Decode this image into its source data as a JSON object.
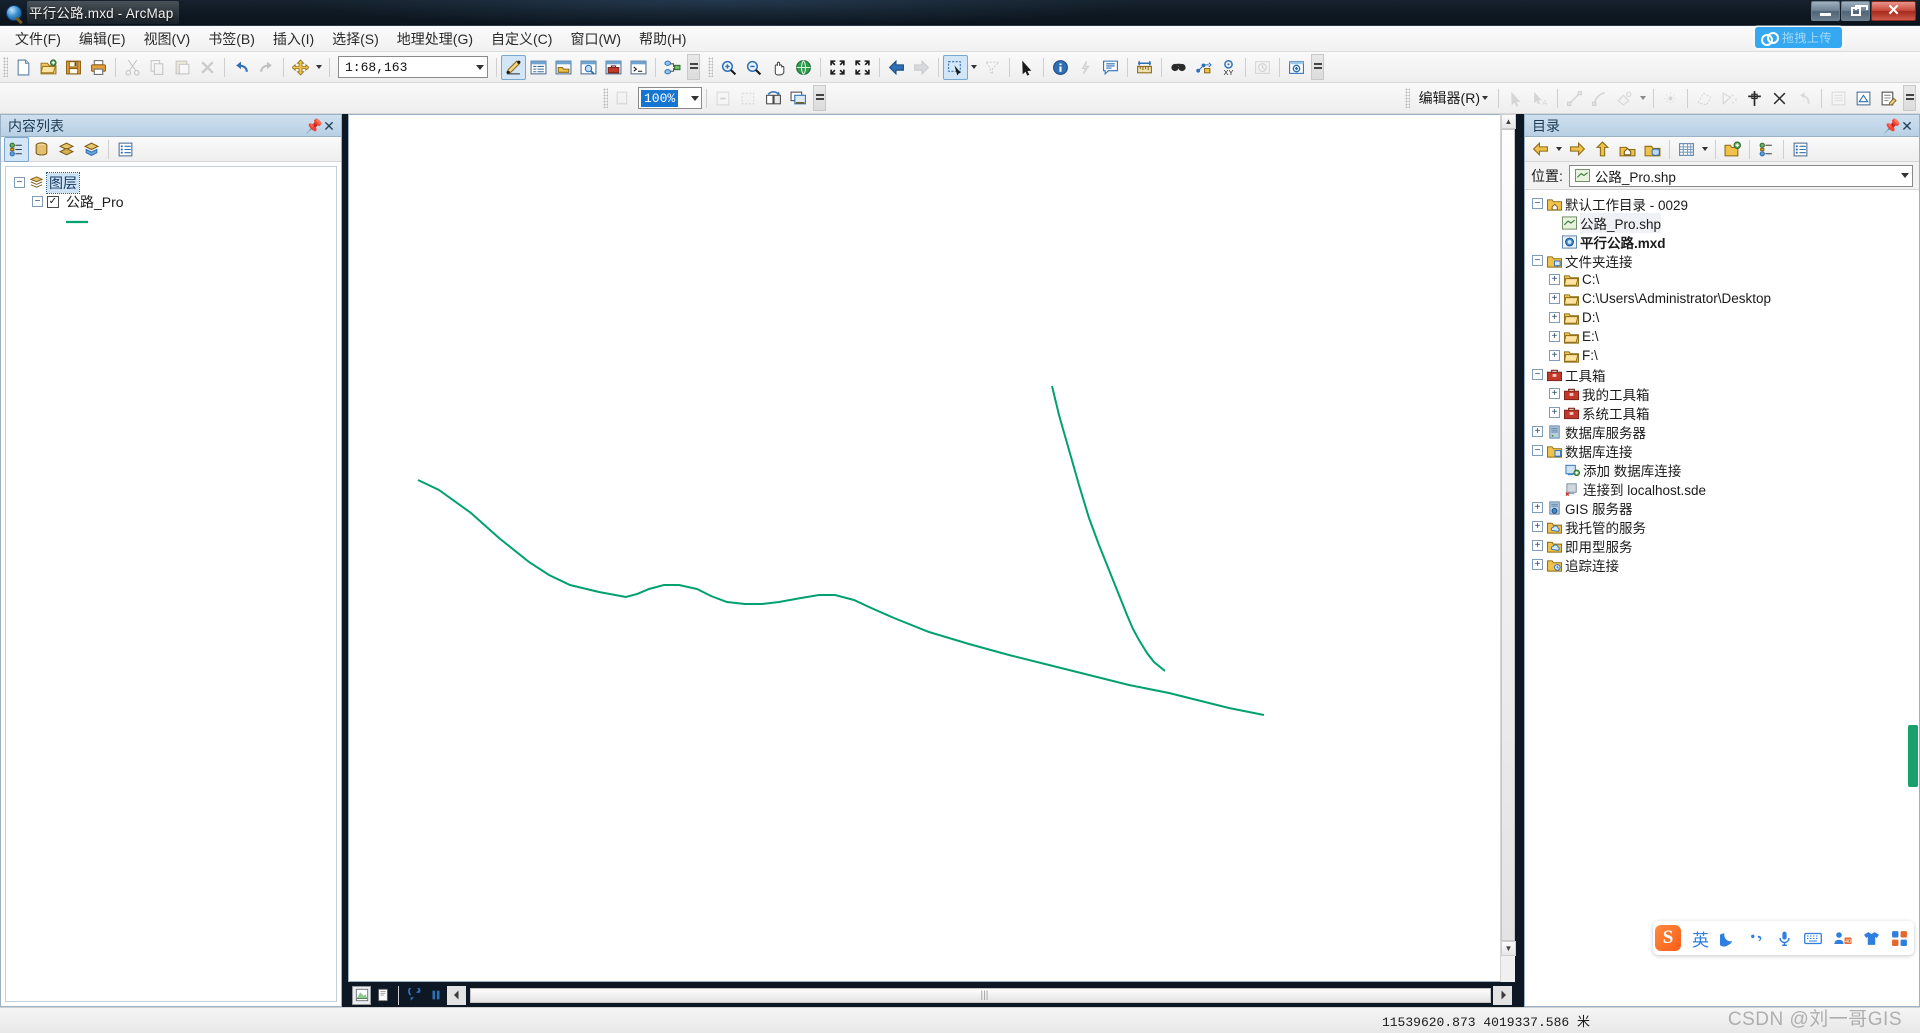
{
  "window": {
    "title": "平行公路.mxd - ArcMap",
    "minimize_label": "最小化",
    "maximize_label": "最大化",
    "close_label": "关闭"
  },
  "upload_chip": {
    "label": "拖拽上传"
  },
  "menubar": {
    "items": [
      {
        "label": "文件(F)",
        "name": "menu-file"
      },
      {
        "label": "编辑(E)",
        "name": "menu-edit"
      },
      {
        "label": "视图(V)",
        "name": "menu-view"
      },
      {
        "label": "书签(B)",
        "name": "menu-bookmarks"
      },
      {
        "label": "插入(I)",
        "name": "menu-insert"
      },
      {
        "label": "选择(S)",
        "name": "menu-selection"
      },
      {
        "label": "地理处理(G)",
        "name": "menu-geoprocessing"
      },
      {
        "label": "自定义(C)",
        "name": "menu-customize"
      },
      {
        "label": "窗口(W)",
        "name": "menu-window"
      },
      {
        "label": "帮助(H)",
        "name": "menu-help"
      }
    ]
  },
  "standard_toolbar": {
    "scale_value": "1:68,163",
    "buttons": [
      "new-map",
      "open-map",
      "save-map",
      "print-map",
      "cut",
      "copy",
      "paste",
      "delete",
      "undo",
      "redo",
      "add-data",
      "add-data-dropdown",
      "scale-combo",
      "editor-toolbar-toggle",
      "table-of-contents",
      "catalog-window",
      "search-window",
      "arctoolbox",
      "python-window",
      "modelbuilder"
    ]
  },
  "tools_toolbar": {
    "buttons": [
      "zoom-in",
      "zoom-out",
      "pan",
      "full-extent",
      "fixed-zoom-in",
      "fixed-zoom-out",
      "go-back-extent",
      "go-forward-extent",
      "select-features",
      "select-dropdown",
      "clear-selection",
      "select-elements",
      "identify",
      "hyperlink",
      "html-popup",
      "measure",
      "find",
      "find-route",
      "go-to-xy",
      "time-slider",
      "create-viewer"
    ]
  },
  "draw_toolbar": {
    "zoom_value": "100%",
    "buttons": [
      "zoom-combo",
      "clear-graphics",
      "select-graphics",
      "rotate-graphics",
      "display-graphics"
    ]
  },
  "editor_toolbar": {
    "label": "编辑器(R)",
    "buttons": [
      "edit-tool",
      "edit-annotation-tool",
      "straight-segment",
      "end-point-arc-segment",
      "trace",
      "trace-dropdown",
      "midpoint",
      "create-features-window",
      "construction-tools",
      "edit-vertices",
      "split-tool",
      "rotate-tool",
      "attributes",
      "sketch-properties",
      "edit-sketch"
    ]
  },
  "toc_panel": {
    "title": "内容列表",
    "toolbar_buttons": [
      "list-by-drawing-order",
      "list-by-source",
      "list-by-visibility",
      "list-by-selection",
      "options"
    ],
    "tree": {
      "root_label": "图层",
      "layer_label": "公路_Pro",
      "layer_checked": true,
      "symbol_color": "#00a070"
    }
  },
  "catalog_panel": {
    "title": "目录",
    "toolbar_buttons": [
      "back",
      "back-dropdown",
      "forward",
      "up-one-level",
      "home",
      "connect-folder",
      "thumbnails",
      "thumbnails-dropdown",
      "connect-to-folder",
      "toggle-tree",
      "catalog-options"
    ],
    "location_label": "位置:",
    "location_value": "公路_Pro.shp",
    "tree": [
      {
        "label": "默认工作目录 - 0029",
        "level": 0,
        "expander": "minus",
        "icon": "home-folder-icon",
        "bold": false
      },
      {
        "label": "公路_Pro.shp",
        "level": 1,
        "expander": "none",
        "icon": "shapefile-line-icon",
        "bold": false,
        "selected": true
      },
      {
        "label": "平行公路.mxd",
        "level": 1,
        "expander": "none",
        "icon": "mxd-icon",
        "bold": true
      },
      {
        "label": "文件夹连接",
        "level": 0,
        "expander": "minus",
        "icon": "folder-connection-icon",
        "bold": false
      },
      {
        "label": "C:\\",
        "level": 1,
        "expander": "plus",
        "icon": "folder-icon",
        "bold": false
      },
      {
        "label": "C:\\Users\\Administrator\\Desktop",
        "level": 1,
        "expander": "plus",
        "icon": "folder-icon",
        "bold": false
      },
      {
        "label": "D:\\",
        "level": 1,
        "expander": "plus",
        "icon": "folder-icon",
        "bold": false
      },
      {
        "label": "E:\\",
        "level": 1,
        "expander": "plus",
        "icon": "folder-icon",
        "bold": false
      },
      {
        "label": "F:\\",
        "level": 1,
        "expander": "plus",
        "icon": "folder-icon",
        "bold": false
      },
      {
        "label": "工具箱",
        "level": 0,
        "expander": "minus",
        "icon": "toolbox-icon",
        "bold": false
      },
      {
        "label": "我的工具箱",
        "level": 1,
        "expander": "plus",
        "icon": "toolbox-icon",
        "bold": false
      },
      {
        "label": "系统工具箱",
        "level": 1,
        "expander": "plus",
        "icon": "toolbox-icon",
        "bold": false
      },
      {
        "label": "数据库服务器",
        "level": 0,
        "expander": "plus",
        "icon": "database-server-icon",
        "bold": false
      },
      {
        "label": "数据库连接",
        "level": 0,
        "expander": "minus",
        "icon": "database-connection-icon",
        "bold": false
      },
      {
        "label": "添加 数据库连接",
        "level": 1,
        "expander": "none",
        "icon": "add-database-icon",
        "bold": false
      },
      {
        "label": "连接到 localhost.sde",
        "level": 1,
        "expander": "none",
        "icon": "sde-connection-icon",
        "bold": false
      },
      {
        "label": "GIS 服务器",
        "level": 0,
        "expander": "plus",
        "icon": "gis-server-icon",
        "bold": false
      },
      {
        "label": "我托管的服务",
        "level": 0,
        "expander": "plus",
        "icon": "cloud-icon",
        "bold": false
      },
      {
        "label": "即用型服务",
        "level": 0,
        "expander": "plus",
        "icon": "cloud-icon",
        "bold": false
      },
      {
        "label": "追踪连接",
        "level": 0,
        "expander": "plus",
        "icon": "tracking-icon",
        "bold": false
      }
    ]
  },
  "map_view": {
    "background_color": "#ffffff",
    "feature_color": "#00a070",
    "view_buttons": [
      "data-view",
      "layout-view",
      "refresh-view",
      "pause-drawing",
      "scroll-left"
    ]
  },
  "status_bar": {
    "coordinates": "11539620.873  4019337.586 米"
  },
  "watermark": {
    "text": "CSDN @刘一哥GIS"
  },
  "ime_bar": {
    "brand": "S",
    "items": [
      "英",
      "moon-icon",
      "punctuation-icon",
      "microphone-icon",
      "keyboard-icon",
      "user-icon",
      "skin-icon",
      "apps-icon"
    ]
  }
}
